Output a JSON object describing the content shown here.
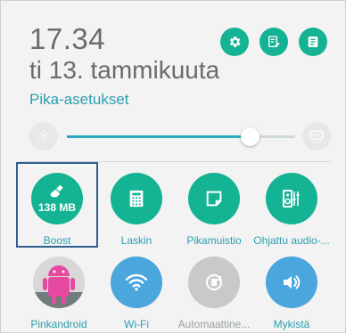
{
  "status": {
    "time": "17.34",
    "date": "ti 13. tammikuuta"
  },
  "section": {
    "title": "Pika-asetukset"
  },
  "brightness": {
    "level": 0.8
  },
  "tiles": [
    {
      "label": "Boost",
      "badge": "138 MB",
      "icon": "broom-icon",
      "active": true
    },
    {
      "label": "Laskin",
      "icon": "calculator-icon",
      "active": true
    },
    {
      "label": "Pikamuistio",
      "icon": "note-icon",
      "active": true
    },
    {
      "label": "Ohjattu audio-...",
      "icon": "audio-wizard-icon",
      "active": true
    },
    {
      "label": "Pinkandroid",
      "icon": "pinkandroid-avatar",
      "active": true
    },
    {
      "label": "Wi-Fi",
      "icon": "wifi-icon",
      "active": true
    },
    {
      "label": "Automaattine...",
      "icon": "auto-rotate-icon",
      "active": false
    },
    {
      "label": "Mykistä",
      "icon": "volume-icon",
      "active": true
    }
  ],
  "colors": {
    "accent": "#14b394",
    "label": "#2a9fb0",
    "inactive": "#c9c9c9",
    "wifi_blue": "#4aa6dd"
  }
}
